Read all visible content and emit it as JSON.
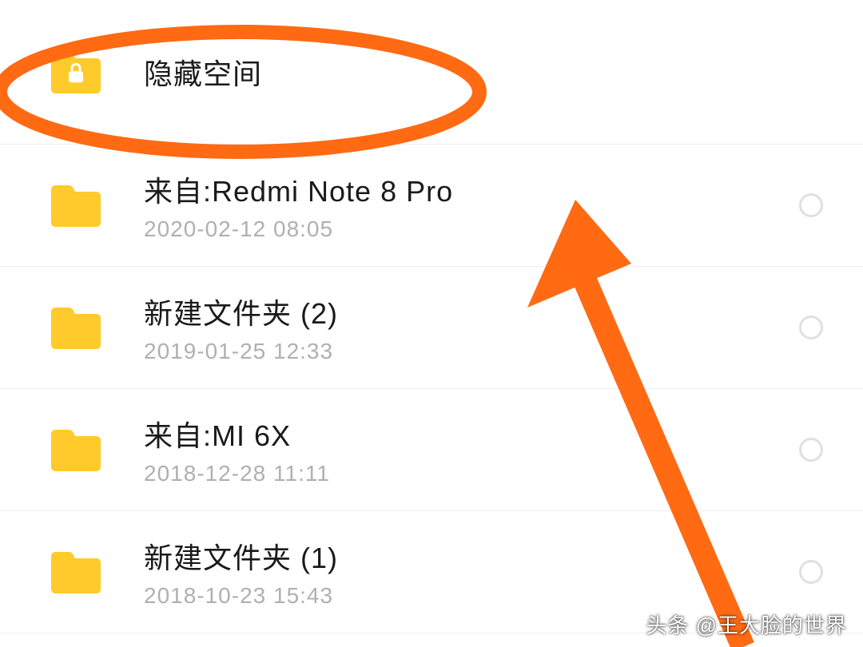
{
  "folders": [
    {
      "name": "隐藏空间",
      "date": "",
      "locked": true
    },
    {
      "name": "来自:Redmi Note 8 Pro",
      "date": "2020-02-12  08:05",
      "locked": false
    },
    {
      "name": "新建文件夹 (2)",
      "date": "2019-01-25  12:33",
      "locked": false
    },
    {
      "name": "来自:MI 6X",
      "date": "2018-12-28  11:11",
      "locked": false
    },
    {
      "name": "新建文件夹 (1)",
      "date": "2018-10-23  15:43",
      "locked": false
    }
  ],
  "watermark": "头条 @王大脸的世界",
  "colors": {
    "folder": "#FFCB2B",
    "annotation": "#FF6A13"
  }
}
